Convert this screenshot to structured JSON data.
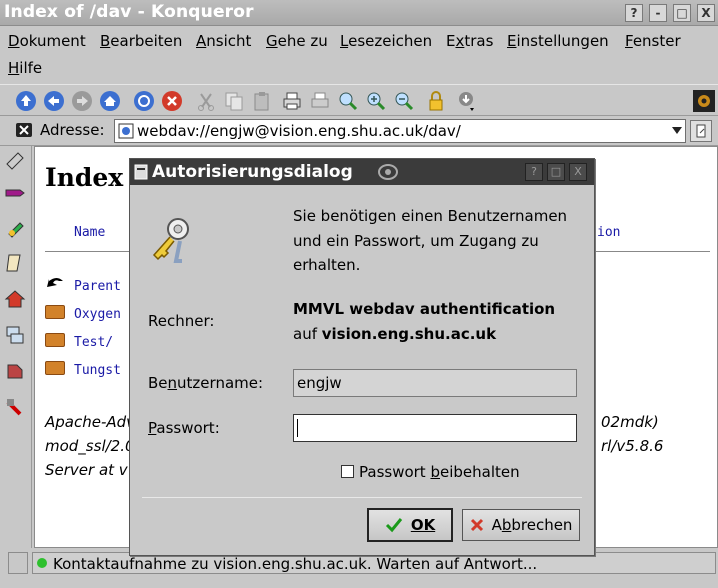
{
  "window": {
    "title": "Index of /dav - Konqueror",
    "controls": [
      "?",
      "-",
      "□",
      "X"
    ]
  },
  "menu": {
    "items": [
      {
        "label": "Dokument",
        "mnemonic": "D"
      },
      {
        "label": "Bearbeiten",
        "mnemonic": "B"
      },
      {
        "label": "Ansicht",
        "mnemonic": "A"
      },
      {
        "label": "Gehe zu",
        "mnemonic": "G"
      },
      {
        "label": "Lesezeichen",
        "mnemonic": "L"
      },
      {
        "label": "Extras",
        "mnemonic": "x"
      },
      {
        "label": "Einstellungen",
        "mnemonic": "E"
      },
      {
        "label": "Fenster",
        "mnemonic": "F"
      },
      {
        "label": "Hilfe",
        "mnemonic": "H"
      }
    ]
  },
  "toolbar": {
    "icons": [
      "up-arrow-icon",
      "back-arrow-icon",
      "forward-arrow-icon",
      "home-icon",
      "reload-icon",
      "stop-icon",
      "cut-icon",
      "copy-icon",
      "paste-icon",
      "print-icon",
      "print-preview-icon",
      "zoom-icon",
      "zoom-in-icon",
      "zoom-out-icon",
      "lock-icon",
      "download-icon",
      "busy-gear-icon"
    ]
  },
  "location": {
    "label": "Adresse:",
    "url": "webdav://engjw@vision.eng.shu.ac.uk/dav/"
  },
  "page": {
    "heading": "Index",
    "column_name": "Name",
    "column_right": "ion",
    "entries": [
      "Parent",
      "Oxygen",
      "Test/",
      "Tungst"
    ],
    "footer_lines": [
      "Apache-Adv",
      "mod_ssl/2.0",
      "Server at v"
    ],
    "footer_right": [
      "02mdk)",
      "rl/v5.8.6"
    ]
  },
  "status": {
    "text": "Kontaktaufnahme zu vision.eng.shu.ac.uk. Warten auf Antwort..."
  },
  "dialog": {
    "title": "Autorisierungsdialog",
    "message_lines": [
      "Sie benötigen einen Benutzernamen",
      "und ein Passwort, um Zugang zu",
      "erhalten."
    ],
    "host_label": "Rechner:",
    "host_realm": "MMVL webdav authentification",
    "host_prefix": "auf",
    "host_name": "vision.eng.shu.ac.uk",
    "username_label": "Benutzername:",
    "username_value": "engjw",
    "password_label": "Passwort:",
    "password_value": "",
    "keep_password_label": "Passwort beibehalten",
    "keep_password_checked": false,
    "ok_label": "OK",
    "cancel_label": "Abbrechen"
  }
}
